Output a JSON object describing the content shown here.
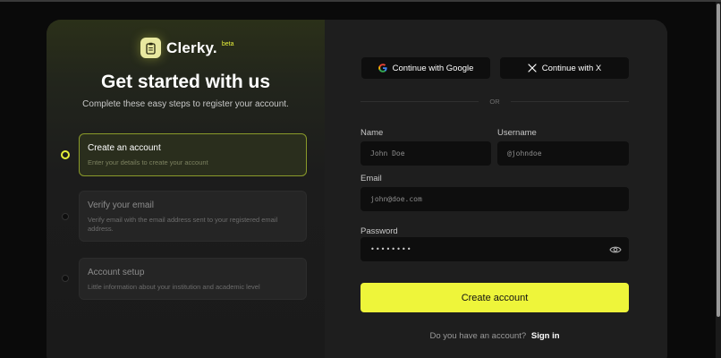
{
  "brand": {
    "name": "Clerky.",
    "tag": "beta",
    "logo_icon": "clipboard-icon",
    "accent": "#eef53a"
  },
  "hero": {
    "title": "Get started with us",
    "subtitle": "Complete these easy steps to register your account."
  },
  "steps": [
    {
      "title": "Create an account",
      "description": "Enter your details to create your account",
      "active": true
    },
    {
      "title": "Verify your email",
      "description": "Verify email with the email address sent to your registered email address.",
      "active": false
    },
    {
      "title": "Account setup",
      "description": "Little information about your institution and academic level",
      "active": false
    }
  ],
  "oauth": {
    "google_label": "Continue with Google",
    "x_label": "Continue with X"
  },
  "divider": {
    "or_label": "OR"
  },
  "form": {
    "name_label": "Name",
    "name_placeholder": "John Doe",
    "username_label": "Username",
    "username_placeholder": "@johndoe",
    "email_label": "Email",
    "email_placeholder": "john@doe.com",
    "password_label": "Password",
    "password_value": "••••••••",
    "submit_label": "Create account"
  },
  "signin": {
    "prompt": "Do you have an account?",
    "link_label": "Sign in"
  }
}
